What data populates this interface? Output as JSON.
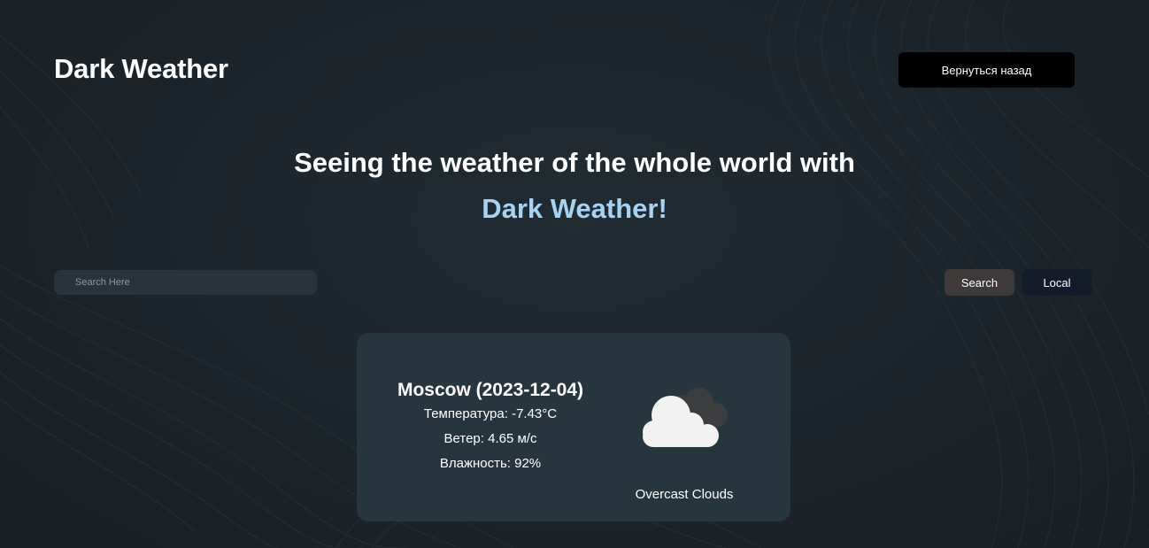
{
  "header": {
    "brand": "Dark Weather",
    "back_button_label": "Вернуться назад"
  },
  "hero": {
    "line1": "Seeing the weather of the whole world with",
    "line2": "Dark Weather!"
  },
  "search": {
    "placeholder": "Search Here",
    "value": "",
    "search_button_label": "Search",
    "local_button_label": "Local"
  },
  "weather_card": {
    "title": "Moscow (2023-12-04)",
    "temperature": "Температура: -7.43°C",
    "wind": "Ветер: 4.65 м/с",
    "humidity": "Влажность: 92%",
    "icon": "overcast-clouds-icon",
    "description": "Overcast Clouds"
  },
  "colors": {
    "background": "#1d252b",
    "card": "#27363e",
    "accent_text": "#a7d3f2",
    "search_button": "#3d3a39",
    "local_button": "#141b2a",
    "back_button": "#000000"
  }
}
